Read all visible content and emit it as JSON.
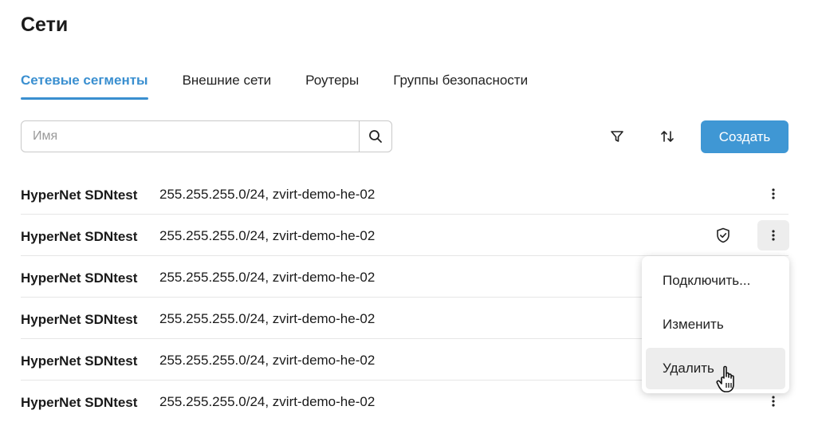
{
  "page": {
    "title": "Сети"
  },
  "tabs": [
    {
      "label": "Сетевые сегменты",
      "active": true
    },
    {
      "label": "Внешние сети",
      "active": false
    },
    {
      "label": "Роутеры",
      "active": false
    },
    {
      "label": "Группы безопасности",
      "active": false
    }
  ],
  "toolbar": {
    "search_placeholder": "Имя",
    "search_value": "",
    "create_label": "Создать",
    "icons": [
      "search-icon",
      "filter-icon",
      "sort-icon"
    ]
  },
  "rows": [
    {
      "name": "HyperNet SDNtest",
      "desc": "255.255.255.0/24, zvirt-demo-he-02"
    },
    {
      "name": "HyperNet SDNtest",
      "desc": "255.255.255.0/24, zvirt-demo-he-02",
      "shield": true,
      "menu_open": true
    },
    {
      "name": "HyperNet SDNtest",
      "desc": "255.255.255.0/24, zvirt-demo-he-02"
    },
    {
      "name": "HyperNet SDNtest",
      "desc": "255.255.255.0/24, zvirt-demo-he-02"
    },
    {
      "name": "HyperNet SDNtest",
      "desc": "255.255.255.0/24, zvirt-demo-he-02"
    },
    {
      "name": "HyperNet SDNtest",
      "desc": "255.255.255.0/24, zvirt-demo-he-02"
    }
  ],
  "context_menu": {
    "items": [
      {
        "label": "Подключить..."
      },
      {
        "label": "Изменить"
      },
      {
        "label": "Удалить",
        "hovered": true
      }
    ]
  },
  "colors": {
    "accent": "#3a8fd0",
    "button": "#3f97d4",
    "hover": "#ededed",
    "divider": "#e6e6e6"
  }
}
